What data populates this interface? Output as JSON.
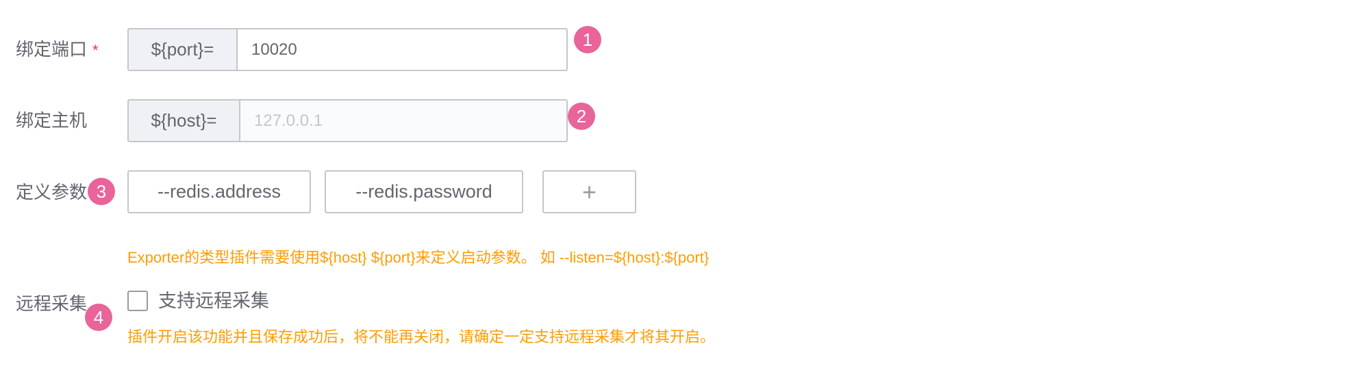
{
  "port": {
    "label": "绑定端口",
    "required_mark": "*",
    "prefix": "${port}=",
    "value": "10020",
    "badge": "1"
  },
  "host": {
    "label": "绑定主机",
    "prefix": "${host}=",
    "placeholder": "127.0.0.1",
    "badge": "2"
  },
  "params": {
    "label": "定义参数",
    "items": [
      "--redis.address",
      "--redis.password"
    ],
    "add_symbol": "+",
    "badge": "3",
    "tip": "Exporter的类型插件需要使用${host} ${port}来定义启动参数。 如 --listen=${host}:${port}"
  },
  "remote": {
    "label": "远程采集",
    "checkbox_label": "支持远程采集",
    "checked": false,
    "badge": "4",
    "tip": "插件开启该功能并且保存成功后，将不能再关闭，请确定一定支持远程采集才将其开启。"
  },
  "colors": {
    "badge": "#e8649a",
    "warning": "#ff9c01",
    "required": "#ea3636"
  }
}
